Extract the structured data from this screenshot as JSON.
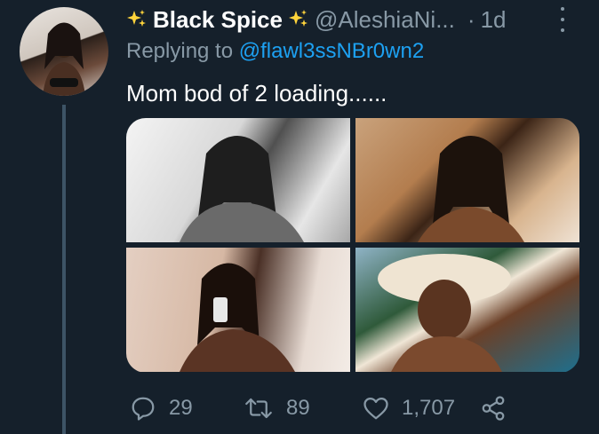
{
  "tweet": {
    "display_name": "Black Spice",
    "handle": "@AleshiaNi...",
    "separator": "·",
    "time": "1d",
    "replying_prefix": "Replying to",
    "replying_to": "@flawl3ssNBr0wn2",
    "text": "Mom bod of 2 loading......",
    "media": [
      {
        "alt": "photo-1"
      },
      {
        "alt": "photo-2"
      },
      {
        "alt": "photo-3"
      },
      {
        "alt": "photo-4"
      }
    ]
  },
  "actions": {
    "replies": "29",
    "retweets": "89",
    "likes": "1,707"
  },
  "icons": {
    "name_decoration": "sparkles-icon",
    "reply": "comment-icon",
    "retweet": "retweet-icon",
    "like": "heart-icon",
    "share": "share-icon",
    "more": "more-vertical-icon"
  },
  "colors": {
    "background": "#15202b",
    "secondary_text": "#8899a6",
    "link": "#1da1f2",
    "sparkle": "#ffd43b"
  }
}
